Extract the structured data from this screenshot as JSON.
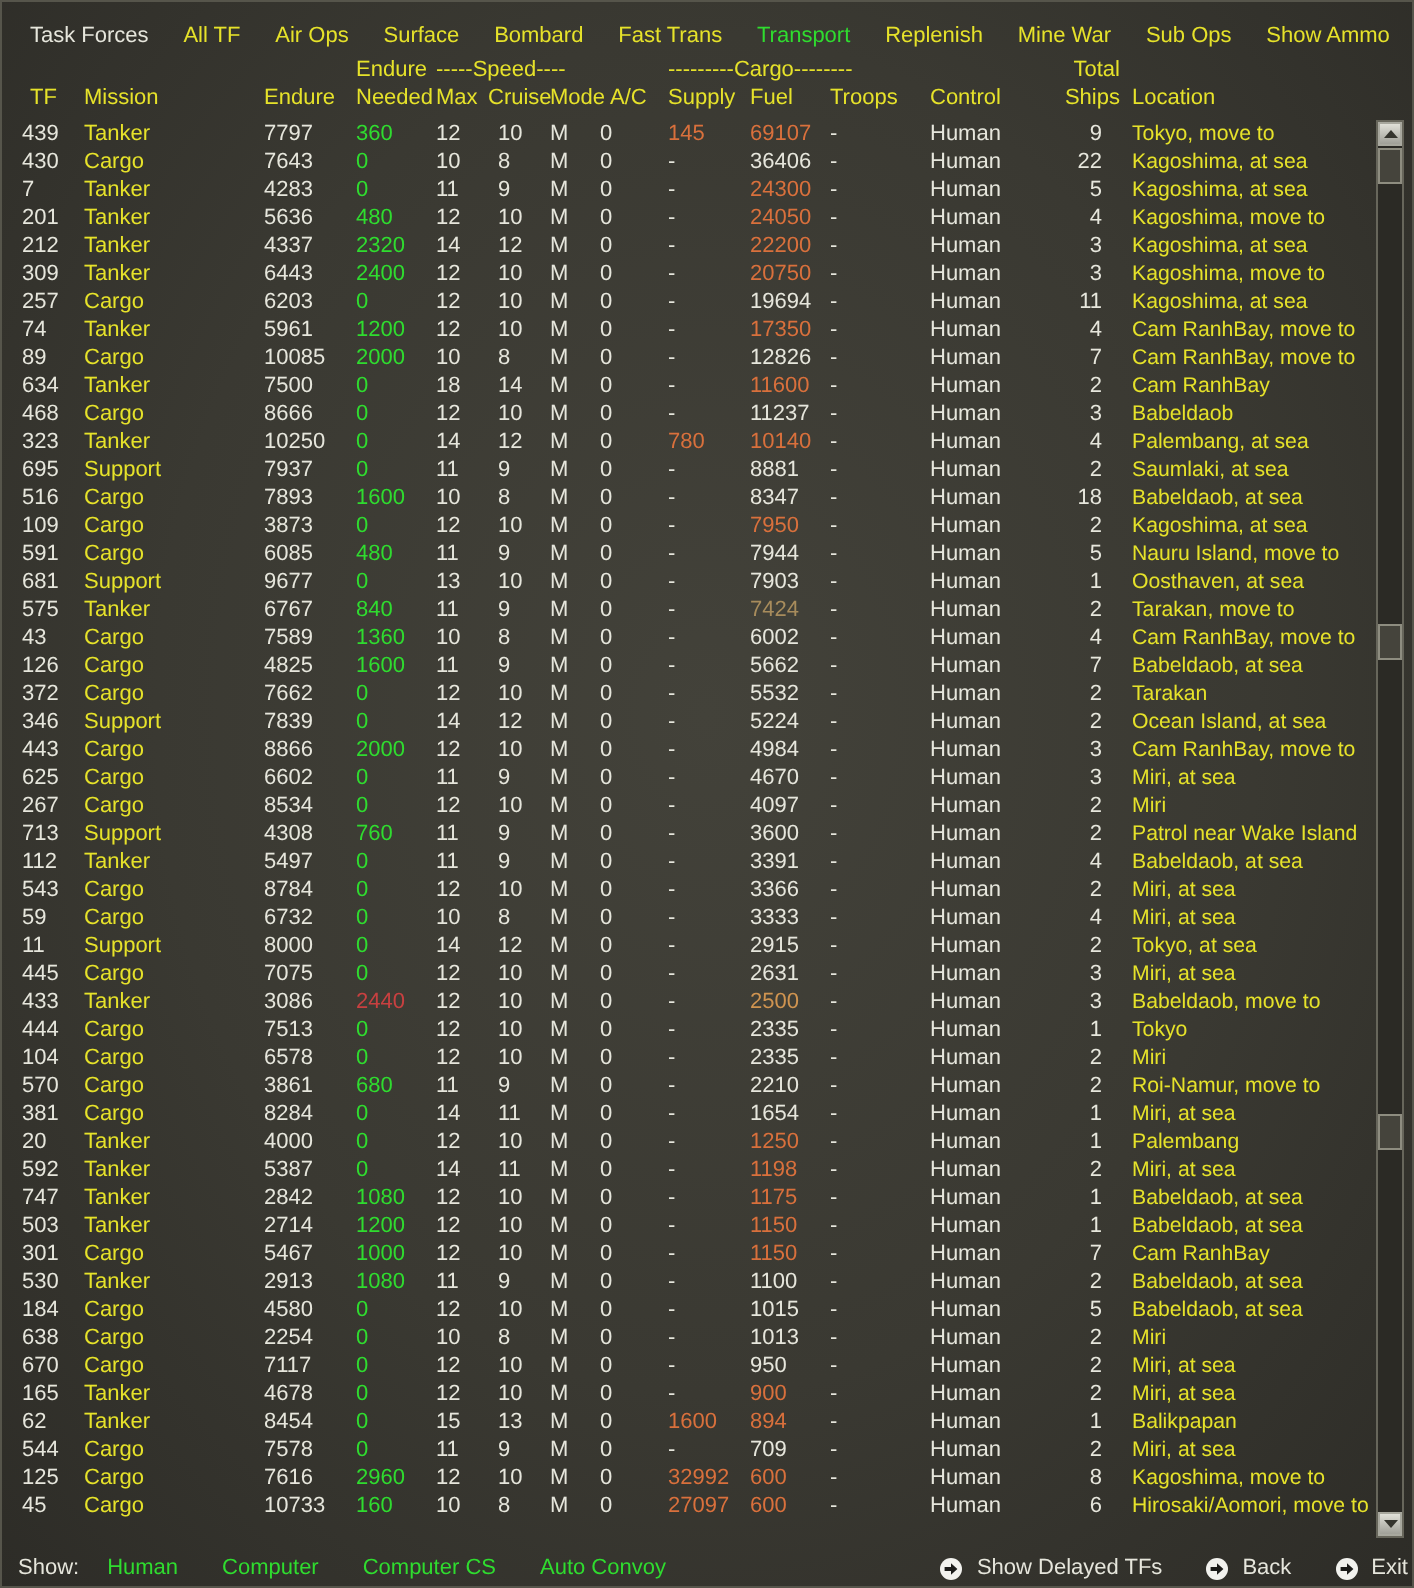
{
  "window": {
    "title": "Task Forces"
  },
  "tabs": [
    {
      "label": "All TF",
      "selected": false
    },
    {
      "label": "Air Ops",
      "selected": false
    },
    {
      "label": "Surface",
      "selected": false
    },
    {
      "label": "Bombard",
      "selected": false
    },
    {
      "label": "Fast Trans",
      "selected": false
    },
    {
      "label": "Transport",
      "selected": true
    },
    {
      "label": "Replenish",
      "selected": false
    },
    {
      "label": "Mine War",
      "selected": false
    },
    {
      "label": "Sub Ops",
      "selected": false
    }
  ],
  "show_ammo": {
    "label": "Show Ammo"
  },
  "table": {
    "header_groups": [
      {
        "columns": [
          "TF",
          "Mission",
          "Endure"
        ]
      },
      {
        "label": "Endure",
        "columns": [
          "Needed"
        ]
      },
      {
        "label": "-----Speed----",
        "columns": [
          "Max",
          "Cruise",
          "Mode"
        ]
      },
      {
        "columns": [
          "A/C"
        ]
      },
      {
        "label": "---------Cargo--------",
        "columns": [
          "Supply",
          "Fuel",
          "Troops"
        ]
      },
      {
        "columns": [
          "Control"
        ]
      },
      {
        "label": "Total",
        "columns": [
          "Ships"
        ]
      },
      {
        "columns": [
          "Location"
        ]
      }
    ],
    "rows": [
      [
        "439",
        "Tanker",
        "7797",
        {
          "text": "360",
          "color": "#2fdc2f"
        },
        "12",
        "10",
        "M",
        "0",
        {
          "text": "145",
          "color": "#d9703c"
        },
        {
          "text": "69107",
          "color": "#d9703c"
        },
        "-",
        "Human",
        "9",
        "Tokyo, move to"
      ],
      [
        "430",
        "Cargo",
        "7643",
        {
          "text": "0",
          "color": "#2fdc2f"
        },
        "10",
        "8",
        "M",
        "0",
        {
          "text": "-",
          "color": "#e6e6dc"
        },
        {
          "text": "36406",
          "color": "#e6e6dc"
        },
        "-",
        "Human",
        "22",
        "Kagoshima, at sea"
      ],
      [
        "7",
        "Tanker",
        "4283",
        {
          "text": "0",
          "color": "#2fdc2f"
        },
        "11",
        "9",
        "M",
        "0",
        {
          "text": "-",
          "color": "#e6e6dc"
        },
        {
          "text": "24300",
          "color": "#d9703c"
        },
        "-",
        "Human",
        "5",
        "Kagoshima, at sea"
      ],
      [
        "201",
        "Tanker",
        "5636",
        {
          "text": "480",
          "color": "#2fdc2f"
        },
        "12",
        "10",
        "M",
        "0",
        {
          "text": "-",
          "color": "#e6e6dc"
        },
        {
          "text": "24050",
          "color": "#d9703c"
        },
        "-",
        "Human",
        "4",
        "Kagoshima, move to"
      ],
      [
        "212",
        "Tanker",
        "4337",
        {
          "text": "2320",
          "color": "#2fdc2f"
        },
        "14",
        "12",
        "M",
        "0",
        {
          "text": "-",
          "color": "#e6e6dc"
        },
        {
          "text": "22200",
          "color": "#d9703c"
        },
        "-",
        "Human",
        "3",
        "Kagoshima, at sea"
      ],
      [
        "309",
        "Tanker",
        "6443",
        {
          "text": "2400",
          "color": "#2fdc2f"
        },
        "12",
        "10",
        "M",
        "0",
        {
          "text": "-",
          "color": "#e6e6dc"
        },
        {
          "text": "20750",
          "color": "#d9703c"
        },
        "-",
        "Human",
        "3",
        "Kagoshima, move to"
      ],
      [
        "257",
        "Cargo",
        "6203",
        {
          "text": "0",
          "color": "#2fdc2f"
        },
        "12",
        "10",
        "M",
        "0",
        {
          "text": "-",
          "color": "#e6e6dc"
        },
        {
          "text": "19694",
          "color": "#e6e6dc"
        },
        "-",
        "Human",
        "11",
        "Kagoshima, at sea"
      ],
      [
        "74",
        "Tanker",
        "5961",
        {
          "text": "1200",
          "color": "#2fdc2f"
        },
        "12",
        "10",
        "M",
        "0",
        {
          "text": "-",
          "color": "#e6e6dc"
        },
        {
          "text": "17350",
          "color": "#d9703c"
        },
        "-",
        "Human",
        "4",
        "Cam RanhBay, move to"
      ],
      [
        "89",
        "Cargo",
        "10085",
        {
          "text": "2000",
          "color": "#2fdc2f"
        },
        "10",
        "8",
        "M",
        "0",
        {
          "text": "-",
          "color": "#e6e6dc"
        },
        {
          "text": "12826",
          "color": "#e6e6dc"
        },
        "-",
        "Human",
        "7",
        "Cam RanhBay, move to"
      ],
      [
        "634",
        "Tanker",
        "7500",
        {
          "text": "0",
          "color": "#2fdc2f"
        },
        "18",
        "14",
        "M",
        "0",
        {
          "text": "-",
          "color": "#e6e6dc"
        },
        {
          "text": "11600",
          "color": "#d9703c"
        },
        "-",
        "Human",
        "2",
        "Cam RanhBay"
      ],
      [
        "468",
        "Cargo",
        "8666",
        {
          "text": "0",
          "color": "#2fdc2f"
        },
        "12",
        "10",
        "M",
        "0",
        {
          "text": "-",
          "color": "#e6e6dc"
        },
        {
          "text": "11237",
          "color": "#e6e6dc"
        },
        "-",
        "Human",
        "3",
        "Babeldaob"
      ],
      [
        "323",
        "Tanker",
        "10250",
        {
          "text": "0",
          "color": "#2fdc2f"
        },
        "14",
        "12",
        "M",
        "0",
        {
          "text": "780",
          "color": "#d9703c"
        },
        {
          "text": "10140",
          "color": "#d9703c"
        },
        "-",
        "Human",
        "4",
        "Palembang, at sea"
      ],
      [
        "695",
        "Support",
        "7937",
        {
          "text": "0",
          "color": "#2fdc2f"
        },
        "11",
        "9",
        "M",
        "0",
        {
          "text": "-",
          "color": "#e6e6dc"
        },
        {
          "text": "8881",
          "color": "#e6e6dc"
        },
        "-",
        "Human",
        "2",
        "Saumlaki, at sea"
      ],
      [
        "516",
        "Cargo",
        "7893",
        {
          "text": "1600",
          "color": "#2fdc2f"
        },
        "10",
        "8",
        "M",
        "0",
        {
          "text": "-",
          "color": "#e6e6dc"
        },
        {
          "text": "8347",
          "color": "#e6e6dc"
        },
        "-",
        "Human",
        "18",
        "Babeldaob, at sea"
      ],
      [
        "109",
        "Cargo",
        "3873",
        {
          "text": "0",
          "color": "#2fdc2f"
        },
        "12",
        "10",
        "M",
        "0",
        {
          "text": "-",
          "color": "#e6e6dc"
        },
        {
          "text": "7950",
          "color": "#d9703c"
        },
        "-",
        "Human",
        "2",
        "Kagoshima, at sea"
      ],
      [
        "591",
        "Cargo",
        "6085",
        {
          "text": "480",
          "color": "#2fdc2f"
        },
        "11",
        "9",
        "M",
        "0",
        {
          "text": "-",
          "color": "#e6e6dc"
        },
        {
          "text": "7944",
          "color": "#e6e6dc"
        },
        "-",
        "Human",
        "5",
        "Nauru Island, move to"
      ],
      [
        "681",
        "Support",
        "9677",
        {
          "text": "0",
          "color": "#2fdc2f"
        },
        "13",
        "10",
        "M",
        "0",
        {
          "text": "-",
          "color": "#e6e6dc"
        },
        {
          "text": "7903",
          "color": "#e6e6dc"
        },
        "-",
        "Human",
        "1",
        "Oosthaven, at sea"
      ],
      [
        "575",
        "Tanker",
        "6767",
        {
          "text": "840",
          "color": "#2fdc2f"
        },
        "11",
        "9",
        "M",
        "0",
        {
          "text": "-",
          "color": "#e6e6dc"
        },
        {
          "text": "7424",
          "color": "#a88c5c"
        },
        "-",
        "Human",
        "2",
        "Tarakan, move to"
      ],
      [
        "43",
        "Cargo",
        "7589",
        {
          "text": "1360",
          "color": "#2fdc2f"
        },
        "10",
        "8",
        "M",
        "0",
        {
          "text": "-",
          "color": "#e6e6dc"
        },
        {
          "text": "6002",
          "color": "#e6e6dc"
        },
        "-",
        "Human",
        "4",
        "Cam RanhBay, move to"
      ],
      [
        "126",
        "Cargo",
        "4825",
        {
          "text": "1600",
          "color": "#2fdc2f"
        },
        "11",
        "9",
        "M",
        "0",
        {
          "text": "-",
          "color": "#e6e6dc"
        },
        {
          "text": "5662",
          "color": "#e6e6dc"
        },
        "-",
        "Human",
        "7",
        "Babeldaob, at sea"
      ],
      [
        "372",
        "Cargo",
        "7662",
        {
          "text": "0",
          "color": "#2fdc2f"
        },
        "12",
        "10",
        "M",
        "0",
        {
          "text": "-",
          "color": "#e6e6dc"
        },
        {
          "text": "5532",
          "color": "#e6e6dc"
        },
        "-",
        "Human",
        "2",
        "Tarakan"
      ],
      [
        "346",
        "Support",
        "7839",
        {
          "text": "0",
          "color": "#2fdc2f"
        },
        "14",
        "12",
        "M",
        "0",
        {
          "text": "-",
          "color": "#e6e6dc"
        },
        {
          "text": "5224",
          "color": "#e6e6dc"
        },
        "-",
        "Human",
        "2",
        "Ocean Island, at sea"
      ],
      [
        "443",
        "Cargo",
        "8866",
        {
          "text": "2000",
          "color": "#2fdc2f"
        },
        "12",
        "10",
        "M",
        "0",
        {
          "text": "-",
          "color": "#e6e6dc"
        },
        {
          "text": "4984",
          "color": "#e6e6dc"
        },
        "-",
        "Human",
        "3",
        "Cam RanhBay, move to"
      ],
      [
        "625",
        "Cargo",
        "6602",
        {
          "text": "0",
          "color": "#2fdc2f"
        },
        "11",
        "9",
        "M",
        "0",
        {
          "text": "-",
          "color": "#e6e6dc"
        },
        {
          "text": "4670",
          "color": "#e6e6dc"
        },
        "-",
        "Human",
        "3",
        "Miri, at sea"
      ],
      [
        "267",
        "Cargo",
        "8534",
        {
          "text": "0",
          "color": "#2fdc2f"
        },
        "12",
        "10",
        "M",
        "0",
        {
          "text": "-",
          "color": "#e6e6dc"
        },
        {
          "text": "4097",
          "color": "#e6e6dc"
        },
        "-",
        "Human",
        "2",
        "Miri"
      ],
      [
        "713",
        "Support",
        "4308",
        {
          "text": "760",
          "color": "#2fdc2f"
        },
        "11",
        "9",
        "M",
        "0",
        {
          "text": "-",
          "color": "#e6e6dc"
        },
        {
          "text": "3600",
          "color": "#e6e6dc"
        },
        "-",
        "Human",
        "2",
        "Patrol near Wake Island"
      ],
      [
        "112",
        "Tanker",
        "5497",
        {
          "text": "0",
          "color": "#2fdc2f"
        },
        "11",
        "9",
        "M",
        "0",
        {
          "text": "-",
          "color": "#e6e6dc"
        },
        {
          "text": "3391",
          "color": "#e6e6dc"
        },
        "-",
        "Human",
        "4",
        "Babeldaob, at sea"
      ],
      [
        "543",
        "Cargo",
        "8784",
        {
          "text": "0",
          "color": "#2fdc2f"
        },
        "12",
        "10",
        "M",
        "0",
        {
          "text": "-",
          "color": "#e6e6dc"
        },
        {
          "text": "3366",
          "color": "#e6e6dc"
        },
        "-",
        "Human",
        "2",
        "Miri, at sea"
      ],
      [
        "59",
        "Cargo",
        "6732",
        {
          "text": "0",
          "color": "#2fdc2f"
        },
        "10",
        "8",
        "M",
        "0",
        {
          "text": "-",
          "color": "#e6e6dc"
        },
        {
          "text": "3333",
          "color": "#e6e6dc"
        },
        "-",
        "Human",
        "4",
        "Miri, at sea"
      ],
      [
        "11",
        "Support",
        "8000",
        {
          "text": "0",
          "color": "#2fdc2f"
        },
        "14",
        "12",
        "M",
        "0",
        {
          "text": "-",
          "color": "#e6e6dc"
        },
        {
          "text": "2915",
          "color": "#e6e6dc"
        },
        "-",
        "Human",
        "2",
        "Tokyo, at sea"
      ],
      [
        "445",
        "Cargo",
        "7075",
        {
          "text": "0",
          "color": "#2fdc2f"
        },
        "12",
        "10",
        "M",
        "0",
        {
          "text": "-",
          "color": "#e6e6dc"
        },
        {
          "text": "2631",
          "color": "#e6e6dc"
        },
        "-",
        "Human",
        "3",
        "Miri, at sea"
      ],
      [
        "433",
        "Tanker",
        "3086",
        {
          "text": "2440",
          "color": "#c84040"
        },
        "12",
        "10",
        "M",
        "0",
        {
          "text": "-",
          "color": "#e6e6dc"
        },
        {
          "text": "2500",
          "color": "#d09450"
        },
        "-",
        "Human",
        "3",
        "Babeldaob, move to"
      ],
      [
        "444",
        "Cargo",
        "7513",
        {
          "text": "0",
          "color": "#2fdc2f"
        },
        "12",
        "10",
        "M",
        "0",
        {
          "text": "-",
          "color": "#e6e6dc"
        },
        {
          "text": "2335",
          "color": "#e6e6dc"
        },
        "-",
        "Human",
        "1",
        "Tokyo"
      ],
      [
        "104",
        "Cargo",
        "6578",
        {
          "text": "0",
          "color": "#2fdc2f"
        },
        "12",
        "10",
        "M",
        "0",
        {
          "text": "-",
          "color": "#e6e6dc"
        },
        {
          "text": "2335",
          "color": "#e6e6dc"
        },
        "-",
        "Human",
        "2",
        "Miri"
      ],
      [
        "570",
        "Cargo",
        "3861",
        {
          "text": "680",
          "color": "#2fdc2f"
        },
        "11",
        "9",
        "M",
        "0",
        {
          "text": "-",
          "color": "#e6e6dc"
        },
        {
          "text": "2210",
          "color": "#e6e6dc"
        },
        "-",
        "Human",
        "2",
        "Roi-Namur, move to"
      ],
      [
        "381",
        "Cargo",
        "8284",
        {
          "text": "0",
          "color": "#2fdc2f"
        },
        "14",
        "11",
        "M",
        "0",
        {
          "text": "-",
          "color": "#e6e6dc"
        },
        {
          "text": "1654",
          "color": "#e6e6dc"
        },
        "-",
        "Human",
        "1",
        "Miri, at sea"
      ],
      [
        "20",
        "Tanker",
        "4000",
        {
          "text": "0",
          "color": "#2fdc2f"
        },
        "12",
        "10",
        "M",
        "0",
        {
          "text": "-",
          "color": "#e6e6dc"
        },
        {
          "text": "1250",
          "color": "#d9703c"
        },
        "-",
        "Human",
        "1",
        "Palembang"
      ],
      [
        "592",
        "Tanker",
        "5387",
        {
          "text": "0",
          "color": "#2fdc2f"
        },
        "14",
        "11",
        "M",
        "0",
        {
          "text": "-",
          "color": "#e6e6dc"
        },
        {
          "text": "1198",
          "color": "#d9703c"
        },
        "-",
        "Human",
        "2",
        "Miri, at sea"
      ],
      [
        "747",
        "Tanker",
        "2842",
        {
          "text": "1080",
          "color": "#2fdc2f"
        },
        "12",
        "10",
        "M",
        "0",
        {
          "text": "-",
          "color": "#e6e6dc"
        },
        {
          "text": "1175",
          "color": "#d9703c"
        },
        "-",
        "Human",
        "1",
        "Babeldaob, at sea"
      ],
      [
        "503",
        "Tanker",
        "2714",
        {
          "text": "1200",
          "color": "#2fdc2f"
        },
        "12",
        "10",
        "M",
        "0",
        {
          "text": "-",
          "color": "#e6e6dc"
        },
        {
          "text": "1150",
          "color": "#d9703c"
        },
        "-",
        "Human",
        "1",
        "Babeldaob, at sea"
      ],
      [
        "301",
        "Cargo",
        "5467",
        {
          "text": "1000",
          "color": "#2fdc2f"
        },
        "12",
        "10",
        "M",
        "0",
        {
          "text": "-",
          "color": "#e6e6dc"
        },
        {
          "text": "1150",
          "color": "#d9703c"
        },
        "-",
        "Human",
        "7",
        "Cam RanhBay"
      ],
      [
        "530",
        "Tanker",
        "2913",
        {
          "text": "1080",
          "color": "#2fdc2f"
        },
        "11",
        "9",
        "M",
        "0",
        {
          "text": "-",
          "color": "#e6e6dc"
        },
        {
          "text": "1100",
          "color": "#e6e6dc"
        },
        "-",
        "Human",
        "2",
        "Babeldaob, at sea"
      ],
      [
        "184",
        "Cargo",
        "4580",
        {
          "text": "0",
          "color": "#2fdc2f"
        },
        "12",
        "10",
        "M",
        "0",
        {
          "text": "-",
          "color": "#e6e6dc"
        },
        {
          "text": "1015",
          "color": "#e6e6dc"
        },
        "-",
        "Human",
        "5",
        "Babeldaob, at sea"
      ],
      [
        "638",
        "Cargo",
        "2254",
        {
          "text": "0",
          "color": "#2fdc2f"
        },
        "10",
        "8",
        "M",
        "0",
        {
          "text": "-",
          "color": "#e6e6dc"
        },
        {
          "text": "1013",
          "color": "#e6e6dc"
        },
        "-",
        "Human",
        "2",
        "Miri"
      ],
      [
        "670",
        "Cargo",
        "7117",
        {
          "text": "0",
          "color": "#2fdc2f"
        },
        "12",
        "10",
        "M",
        "0",
        {
          "text": "-",
          "color": "#e6e6dc"
        },
        {
          "text": "950",
          "color": "#e6e6dc"
        },
        "-",
        "Human",
        "2",
        "Miri, at sea"
      ],
      [
        "165",
        "Tanker",
        "4678",
        {
          "text": "0",
          "color": "#2fdc2f"
        },
        "12",
        "10",
        "M",
        "0",
        {
          "text": "-",
          "color": "#e6e6dc"
        },
        {
          "text": "900",
          "color": "#d9703c"
        },
        "-",
        "Human",
        "2",
        "Miri, at sea"
      ],
      [
        "62",
        "Tanker",
        "8454",
        {
          "text": "0",
          "color": "#2fdc2f"
        },
        "15",
        "13",
        "M",
        "0",
        {
          "text": "1600",
          "color": "#d9703c"
        },
        {
          "text": "894",
          "color": "#d9703c"
        },
        "-",
        "Human",
        "1",
        "Balikpapan"
      ],
      [
        "544",
        "Cargo",
        "7578",
        {
          "text": "0",
          "color": "#2fdc2f"
        },
        "11",
        "9",
        "M",
        "0",
        {
          "text": "-",
          "color": "#e6e6dc"
        },
        {
          "text": "709",
          "color": "#e6e6dc"
        },
        "-",
        "Human",
        "2",
        "Miri, at sea"
      ],
      [
        "125",
        "Cargo",
        "7616",
        {
          "text": "2960",
          "color": "#2fdc2f"
        },
        "12",
        "10",
        "M",
        "0",
        {
          "text": "32992",
          "color": "#d9703c"
        },
        {
          "text": "600",
          "color": "#d9703c"
        },
        "-",
        "Human",
        "8",
        "Kagoshima, move to"
      ],
      [
        "45",
        "Cargo",
        "10733",
        {
          "text": "160",
          "color": "#2fdc2f"
        },
        "10",
        "8",
        "M",
        "0",
        {
          "text": "27097",
          "color": "#d9703c"
        },
        {
          "text": "600",
          "color": "#d9703c"
        },
        "-",
        "Human",
        "6",
        "Hirosaki/Aomori, move to"
      ]
    ]
  },
  "footer": {
    "show_label": "Show:",
    "filters": [
      {
        "label": "Human",
        "on": true
      },
      {
        "label": "Computer",
        "on": true
      },
      {
        "label": "Computer CS",
        "on": true
      },
      {
        "label": "Auto Convoy",
        "on": true
      }
    ],
    "buttons": [
      {
        "label": "Show Delayed TFs"
      },
      {
        "label": "Back"
      },
      {
        "label": "Exit"
      }
    ]
  }
}
